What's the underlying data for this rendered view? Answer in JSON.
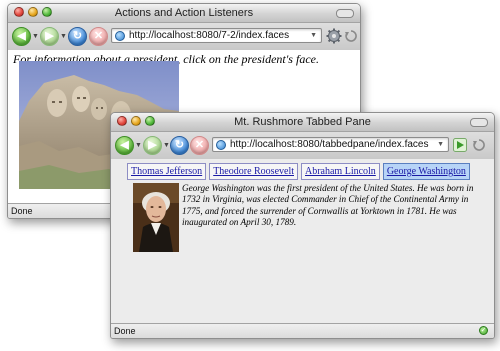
{
  "window1": {
    "title": "Actions and Action Listeners",
    "url": "http://localhost:8080/7-2/index.faces",
    "instruction": "For information about a president, click on the president's face.",
    "status": "Done",
    "icons": [
      "back-icon",
      "forward-icon",
      "reload-icon",
      "stop-icon",
      "globe-icon",
      "gear-icon",
      "spinner-icon"
    ]
  },
  "window2": {
    "title": "Mt. Rushmore Tabbed Pane",
    "url": "http://localhost:8080/tabbedpane/index.faces",
    "tabs": [
      {
        "label": "Thomas Jefferson",
        "selected": false
      },
      {
        "label": "Theodore Roosevelt",
        "selected": false
      },
      {
        "label": "Abraham Lincoln",
        "selected": false
      },
      {
        "label": "George Washington",
        "selected": true
      }
    ],
    "bio": "George Washington was the first president of the United States. He was born in 1732 in Virginia, was elected Commander in Chief of the Continental Army in 1775, and forced the surrender of Cornwallis at Yorktown in 1781. He was inaugurated on April 30, 1789.",
    "status": "Done",
    "icons": [
      "back-icon",
      "forward-icon",
      "reload-icon",
      "stop-icon",
      "globe-icon",
      "go-icon",
      "spinner-icon",
      "check-icon"
    ]
  },
  "colors": {
    "tab_link": "#1a1aa6",
    "tab_selected_bg": "#b7d4f7",
    "window_bg": "#ececec"
  }
}
